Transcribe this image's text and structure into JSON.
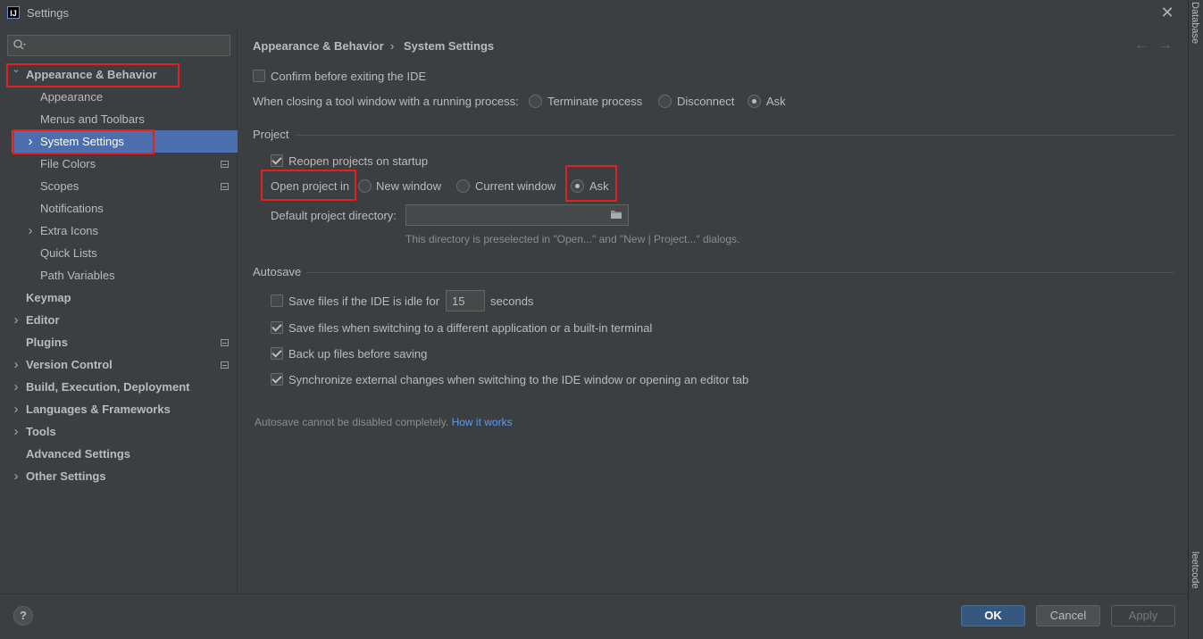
{
  "window": {
    "title": "Settings",
    "logo_text": "IJ"
  },
  "right_strip": {
    "top_label": "Database",
    "bottom_label": "leetcode"
  },
  "sidebar": {
    "search": {
      "placeholder": "",
      "value": ""
    },
    "items": [
      {
        "label": "Appearance & Behavior",
        "bold": true,
        "expanded": true
      },
      {
        "label": "Appearance"
      },
      {
        "label": "Menus and Toolbars"
      },
      {
        "label": "System Settings",
        "selected": true,
        "has_children": true
      },
      {
        "label": "File Colors",
        "project_icon": true
      },
      {
        "label": "Scopes",
        "project_icon": true
      },
      {
        "label": "Notifications"
      },
      {
        "label": "Extra Icons",
        "has_children": true
      },
      {
        "label": "Quick Lists"
      },
      {
        "label": "Path Variables"
      },
      {
        "label": "Keymap",
        "bold": true
      },
      {
        "label": "Editor",
        "bold": true,
        "has_children": true
      },
      {
        "label": "Plugins",
        "bold": true,
        "project_icon": true
      },
      {
        "label": "Version Control",
        "bold": true,
        "has_children": true,
        "project_icon": true
      },
      {
        "label": "Build, Execution, Deployment",
        "bold": true,
        "has_children": true
      },
      {
        "label": "Languages & Frameworks",
        "bold": true,
        "has_children": true
      },
      {
        "label": "Tools",
        "bold": true,
        "has_children": true
      },
      {
        "label": "Advanced Settings",
        "bold": true
      },
      {
        "label": "Other Settings",
        "bold": true,
        "has_children": true
      }
    ]
  },
  "breadcrumb": {
    "parent": "Appearance & Behavior",
    "separator": "›",
    "current": "System Settings"
  },
  "nav": {
    "back": "←",
    "forward": "→"
  },
  "general": {
    "confirm_exit": {
      "label": "Confirm before exiting the IDE",
      "checked": false
    },
    "tool_window": {
      "label": "When closing a tool window with a running process:",
      "options": [
        "Terminate process",
        "Disconnect",
        "Ask"
      ],
      "selected": "Ask"
    }
  },
  "project": {
    "title": "Project",
    "reopen": {
      "label": "Reopen projects on startup",
      "checked": true
    },
    "open_in": {
      "label": "Open project in",
      "options": [
        "New window",
        "Current window",
        "Ask"
      ],
      "selected": "Ask"
    },
    "default_dir": {
      "label": "Default project directory:",
      "value": "",
      "hint": "This directory is preselected in \"Open...\" and \"New | Project...\" dialogs."
    }
  },
  "autosave": {
    "title": "Autosave",
    "idle": {
      "label": "Save files if the IDE is idle for",
      "checked": false,
      "value": "15",
      "unit": "seconds"
    },
    "switch_app": {
      "label": "Save files when switching to a different application or a built-in terminal",
      "checked": true
    },
    "backup": {
      "label": "Back up files before saving",
      "checked": true
    },
    "sync": {
      "label": "Synchronize external changes when switching to the IDE window or opening an editor tab",
      "checked": true
    },
    "note": "Autosave cannot be disabled completely.",
    "note_link": "How it works"
  },
  "footer": {
    "help": "?",
    "ok": "OK",
    "cancel": "Cancel",
    "apply": "Apply"
  },
  "colors": {
    "accent": "#4b6eaf",
    "annotation": "#e81e1e",
    "link": "#589df6",
    "background": "#3c3f41"
  }
}
